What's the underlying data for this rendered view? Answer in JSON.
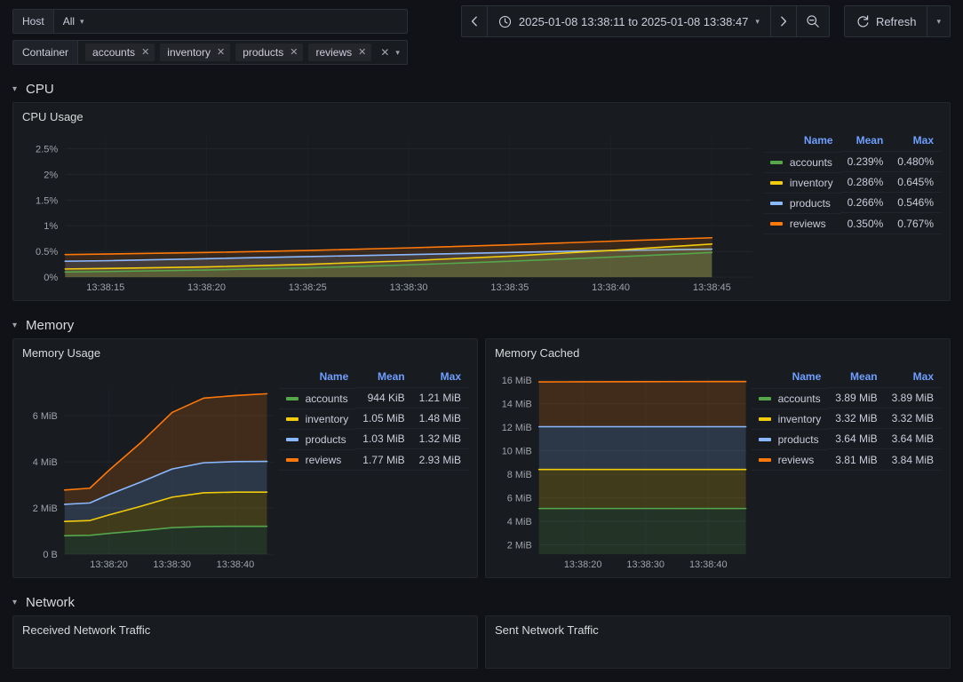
{
  "topbar": {
    "host_variable": {
      "label": "Host",
      "value": "All"
    },
    "container_variable": {
      "label": "Container",
      "chips": [
        "accounts",
        "inventory",
        "products",
        "reviews"
      ],
      "clear_all_icon": "close-icon",
      "dropdown_icon": "chevron-down-icon"
    },
    "time_picker": {
      "prev_icon": "chevron-left-icon",
      "clock_icon": "clock-icon",
      "range": "2025-01-08 13:38:11 to 2025-01-08 13:38:47",
      "dropdown_icon": "chevron-down-icon",
      "next_icon": "chevron-right-icon",
      "zoom_out_icon": "zoom-out-icon"
    },
    "refresh": {
      "label": "Refresh",
      "icon": "refresh-icon",
      "dropdown_icon": "chevron-down-icon"
    }
  },
  "sections": [
    {
      "title": "CPU"
    },
    {
      "title": "Memory"
    },
    {
      "title": "Network"
    }
  ],
  "panels": {
    "cpu_usage": {
      "title": "CPU Usage"
    },
    "memory_usage": {
      "title": "Memory Usage"
    },
    "memory_cached": {
      "title": "Memory Cached"
    },
    "received_network_traffic": {
      "title": "Received Network Traffic"
    },
    "sent_network_traffic": {
      "title": "Sent Network Traffic"
    }
  },
  "legend_headers": {
    "name": "Name",
    "mean": "Mean",
    "max": "Max"
  },
  "colors": {
    "accounts": "#56a64b",
    "inventory": "#f2cc0c",
    "products": "#8ab8ff",
    "reviews": "#ff780a",
    "accent_blue": "#6e9fff",
    "panel_bg": "#181b1f",
    "page_bg": "#111217",
    "text": "#ccccdc"
  },
  "chart_data": [
    {
      "id": "cpu_usage",
      "type": "line",
      "title": "CPU Usage",
      "xlabel": "",
      "ylabel": "",
      "grid": true,
      "legend_position": "right",
      "ylim": [
        0,
        2.75
      ],
      "yticks": [
        "0%",
        "0.5%",
        "1%",
        "1.5%",
        "2%",
        "2.5%"
      ],
      "ytick_values": [
        0,
        0.5,
        1,
        1.5,
        2,
        2.5
      ],
      "xticks": [
        "13:38:15",
        "13:38:20",
        "13:38:25",
        "13:38:30",
        "13:38:35",
        "13:38:40",
        "13:38:45"
      ],
      "x": [
        13,
        15,
        20,
        25,
        30,
        35,
        40,
        45
      ],
      "xlim": [
        13,
        47
      ],
      "series": [
        {
          "name": "accounts",
          "color": "#56a64b",
          "mean": "0.239%",
          "max": "0.480%",
          "values": [
            0.1,
            0.11,
            0.14,
            0.18,
            0.24,
            0.31,
            0.39,
            0.48
          ]
        },
        {
          "name": "inventory",
          "color": "#f2cc0c",
          "mean": "0.286%",
          "max": "0.645%",
          "values": [
            0.16,
            0.17,
            0.2,
            0.25,
            0.32,
            0.41,
            0.52,
            0.645
          ]
        },
        {
          "name": "products",
          "color": "#8ab8ff",
          "mean": "0.266%",
          "max": "0.546%",
          "values": [
            0.31,
            0.32,
            0.36,
            0.4,
            0.44,
            0.48,
            0.52,
            0.546
          ]
        },
        {
          "name": "reviews",
          "color": "#ff780a",
          "mean": "0.350%",
          "max": "0.767%",
          "values": [
            0.44,
            0.45,
            0.48,
            0.52,
            0.57,
            0.63,
            0.7,
            0.767
          ]
        }
      ]
    },
    {
      "id": "memory_usage",
      "type": "area",
      "title": "Memory Usage",
      "stacked": true,
      "grid": true,
      "legend_position": "right",
      "ylim": [
        0,
        7.2
      ],
      "yticks": [
        "0 B",
        "2 MiB",
        "4 MiB",
        "6 MiB"
      ],
      "ytick_values": [
        0,
        2,
        4,
        6
      ],
      "xticks": [
        "13:38:20",
        "13:38:30",
        "13:38:40"
      ],
      "x": [
        13,
        17,
        20,
        25,
        30,
        35,
        40,
        45
      ],
      "xlim": [
        13,
        46
      ],
      "series": [
        {
          "name": "accounts",
          "color": "#56a64b",
          "mean": "944 KiB",
          "max": "1.21 MiB",
          "values": [
            0.8,
            0.82,
            0.9,
            1.02,
            1.15,
            1.2,
            1.21,
            1.21
          ]
        },
        {
          "name": "inventory",
          "color": "#f2cc0c",
          "mean": "1.05 MiB",
          "max": "1.48 MiB",
          "values": [
            0.62,
            0.64,
            0.8,
            1.05,
            1.32,
            1.46,
            1.48,
            1.48
          ]
        },
        {
          "name": "products",
          "color": "#8ab8ff",
          "mean": "1.03 MiB",
          "max": "1.32 MiB",
          "values": [
            0.74,
            0.76,
            0.88,
            1.05,
            1.22,
            1.3,
            1.32,
            1.33
          ]
        },
        {
          "name": "reviews",
          "color": "#ff780a",
          "mean": "1.77 MiB",
          "max": "2.93 MiB",
          "values": [
            0.62,
            0.64,
            1.05,
            1.7,
            2.45,
            2.8,
            2.86,
            2.93
          ]
        }
      ]
    },
    {
      "id": "memory_cached",
      "type": "area",
      "title": "Memory Cached",
      "stacked": true,
      "grid": true,
      "legend_position": "right",
      "ylim": [
        1.2,
        16.4
      ],
      "yticks": [
        "2 MiB",
        "4 MiB",
        "6 MiB",
        "8 MiB",
        "10 MiB",
        "12 MiB",
        "14 MiB",
        "16 MiB"
      ],
      "ytick_values": [
        2,
        4,
        6,
        8,
        10,
        12,
        14,
        16
      ],
      "xticks": [
        "13:38:20",
        "13:38:30",
        "13:38:40"
      ],
      "x": [
        13,
        20,
        30,
        40,
        46
      ],
      "xlim": [
        13,
        46
      ],
      "series": [
        {
          "name": "accounts",
          "color": "#56a64b",
          "mean": "3.89 MiB",
          "max": "3.89 MiB",
          "values": [
            3.89,
            3.89,
            3.89,
            3.89,
            3.89
          ]
        },
        {
          "name": "inventory",
          "color": "#f2cc0c",
          "mean": "3.32 MiB",
          "max": "3.32 MiB",
          "values": [
            3.32,
            3.32,
            3.32,
            3.32,
            3.32
          ]
        },
        {
          "name": "products",
          "color": "#8ab8ff",
          "mean": "3.64 MiB",
          "max": "3.64 MiB",
          "values": [
            3.64,
            3.64,
            3.64,
            3.64,
            3.64
          ]
        },
        {
          "name": "reviews",
          "color": "#ff780a",
          "mean": "3.81 MiB",
          "max": "3.84 MiB",
          "values": [
            3.81,
            3.82,
            3.83,
            3.84,
            3.84
          ]
        }
      ]
    }
  ]
}
